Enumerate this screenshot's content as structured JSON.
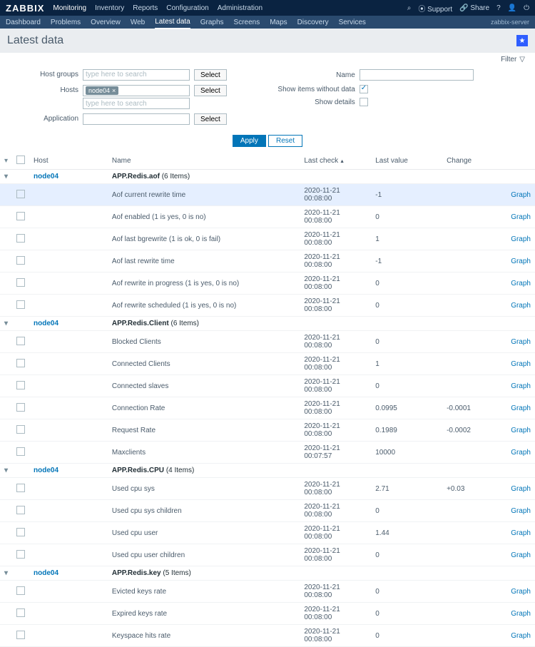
{
  "logo": "ZABBIX",
  "topnav": [
    "Monitoring",
    "Inventory",
    "Reports",
    "Configuration",
    "Administration"
  ],
  "topnav_active": 0,
  "topbar_right": {
    "support": "Support",
    "share": "Share"
  },
  "subnav": [
    "Dashboard",
    "Problems",
    "Overview",
    "Web",
    "Latest data",
    "Graphs",
    "Screens",
    "Maps",
    "Discovery",
    "Services"
  ],
  "subnav_active": 4,
  "server_label": "zabbix-server",
  "page_title": "Latest data",
  "filter_tab": "Filter",
  "filter": {
    "host_groups_label": "Host groups",
    "hosts_label": "Hosts",
    "application_label": "Application",
    "name_label": "Name",
    "show_no_data_label": "Show items without data",
    "show_details_label": "Show details",
    "placeholder": "type here to search",
    "select_btn": "Select",
    "host_tag": "node04",
    "show_no_data_checked": true,
    "show_details_checked": false
  },
  "actions": {
    "apply": "Apply",
    "reset": "Reset"
  },
  "columns": {
    "host": "Host",
    "name": "Name",
    "last_check": "Last check",
    "last_value": "Last value",
    "change": "Change"
  },
  "graph_label": "Graph",
  "groups": [
    {
      "host": "node04",
      "app": "APP.Redis.aof",
      "count_suffix": "(6 Items)",
      "items": [
        {
          "name": "Aof current rewrite time",
          "last_check": "2020-11-21 00:08:00",
          "last_value": "-1",
          "change": "",
          "highlight": true
        },
        {
          "name": "Aof enabled (1 is yes, 0 is no)",
          "last_check": "2020-11-21 00:08:00",
          "last_value": "0",
          "change": ""
        },
        {
          "name": "Aof last bgrewrite (1 is ok, 0 is fail)",
          "last_check": "2020-11-21 00:08:00",
          "last_value": "1",
          "change": ""
        },
        {
          "name": "Aof last rewrite time",
          "last_check": "2020-11-21 00:08:00",
          "last_value": "-1",
          "change": ""
        },
        {
          "name": "Aof rewrite in progress (1 is yes, 0 is no)",
          "last_check": "2020-11-21 00:08:00",
          "last_value": "0",
          "change": ""
        },
        {
          "name": "Aof rewrite scheduled (1 is yes, 0 is no)",
          "last_check": "2020-11-21 00:08:00",
          "last_value": "0",
          "change": ""
        }
      ]
    },
    {
      "host": "node04",
      "app": "APP.Redis.Client",
      "count_suffix": "(6 Items)",
      "items": [
        {
          "name": "Blocked Clients",
          "last_check": "2020-11-21 00:08:00",
          "last_value": "0",
          "change": ""
        },
        {
          "name": "Connected Clients",
          "last_check": "2020-11-21 00:08:00",
          "last_value": "1",
          "change": ""
        },
        {
          "name": "Connected slaves",
          "last_check": "2020-11-21 00:08:00",
          "last_value": "0",
          "change": ""
        },
        {
          "name": "Connection Rate",
          "last_check": "2020-11-21 00:08:00",
          "last_value": "0.0995",
          "change": "-0.0001"
        },
        {
          "name": "Request Rate",
          "last_check": "2020-11-21 00:08:00",
          "last_value": "0.1989",
          "change": "-0.0002"
        },
        {
          "name": "Maxclients",
          "last_check": "2020-11-21 00:07:57",
          "last_value": "10000",
          "change": ""
        }
      ]
    },
    {
      "host": "node04",
      "app": "APP.Redis.CPU",
      "count_suffix": "(4 Items)",
      "items": [
        {
          "name": "Used cpu sys",
          "last_check": "2020-11-21 00:08:00",
          "last_value": "2.71",
          "change": "+0.03"
        },
        {
          "name": "Used cpu sys children",
          "last_check": "2020-11-21 00:08:00",
          "last_value": "0",
          "change": ""
        },
        {
          "name": "Used cpu user",
          "last_check": "2020-11-21 00:08:00",
          "last_value": "1.44",
          "change": ""
        },
        {
          "name": "Used cpu user children",
          "last_check": "2020-11-21 00:08:00",
          "last_value": "0",
          "change": ""
        }
      ]
    },
    {
      "host": "node04",
      "app": "APP.Redis.key",
      "count_suffix": "(5 Items)",
      "items": [
        {
          "name": "Evicted keys rate",
          "last_check": "2020-11-21 00:08:00",
          "last_value": "0",
          "change": ""
        },
        {
          "name": "Expired keys rate",
          "last_check": "2020-11-21 00:08:00",
          "last_value": "0",
          "change": ""
        },
        {
          "name": "Keyspace hits rate",
          "last_check": "2020-11-21 00:08:00",
          "last_value": "0",
          "change": ""
        }
      ]
    }
  ]
}
